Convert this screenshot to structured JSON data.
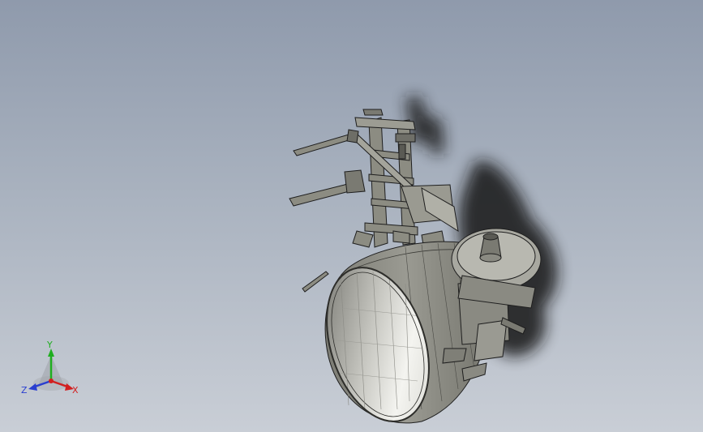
{
  "viewport": {
    "background_top": "#8f9aac",
    "background_bottom": "#c9ced6",
    "model": {
      "body_color": "#8c8c82",
      "edge_color": "#1e1e1e",
      "interior_highlight": "#f0f0ec",
      "shadow_color": "#141414"
    }
  },
  "triad": {
    "x_label": "X",
    "y_label": "Y",
    "z_label": "Z",
    "x_color": "#d22020",
    "y_color": "#1fae1f",
    "z_color": "#2a3fd0"
  }
}
